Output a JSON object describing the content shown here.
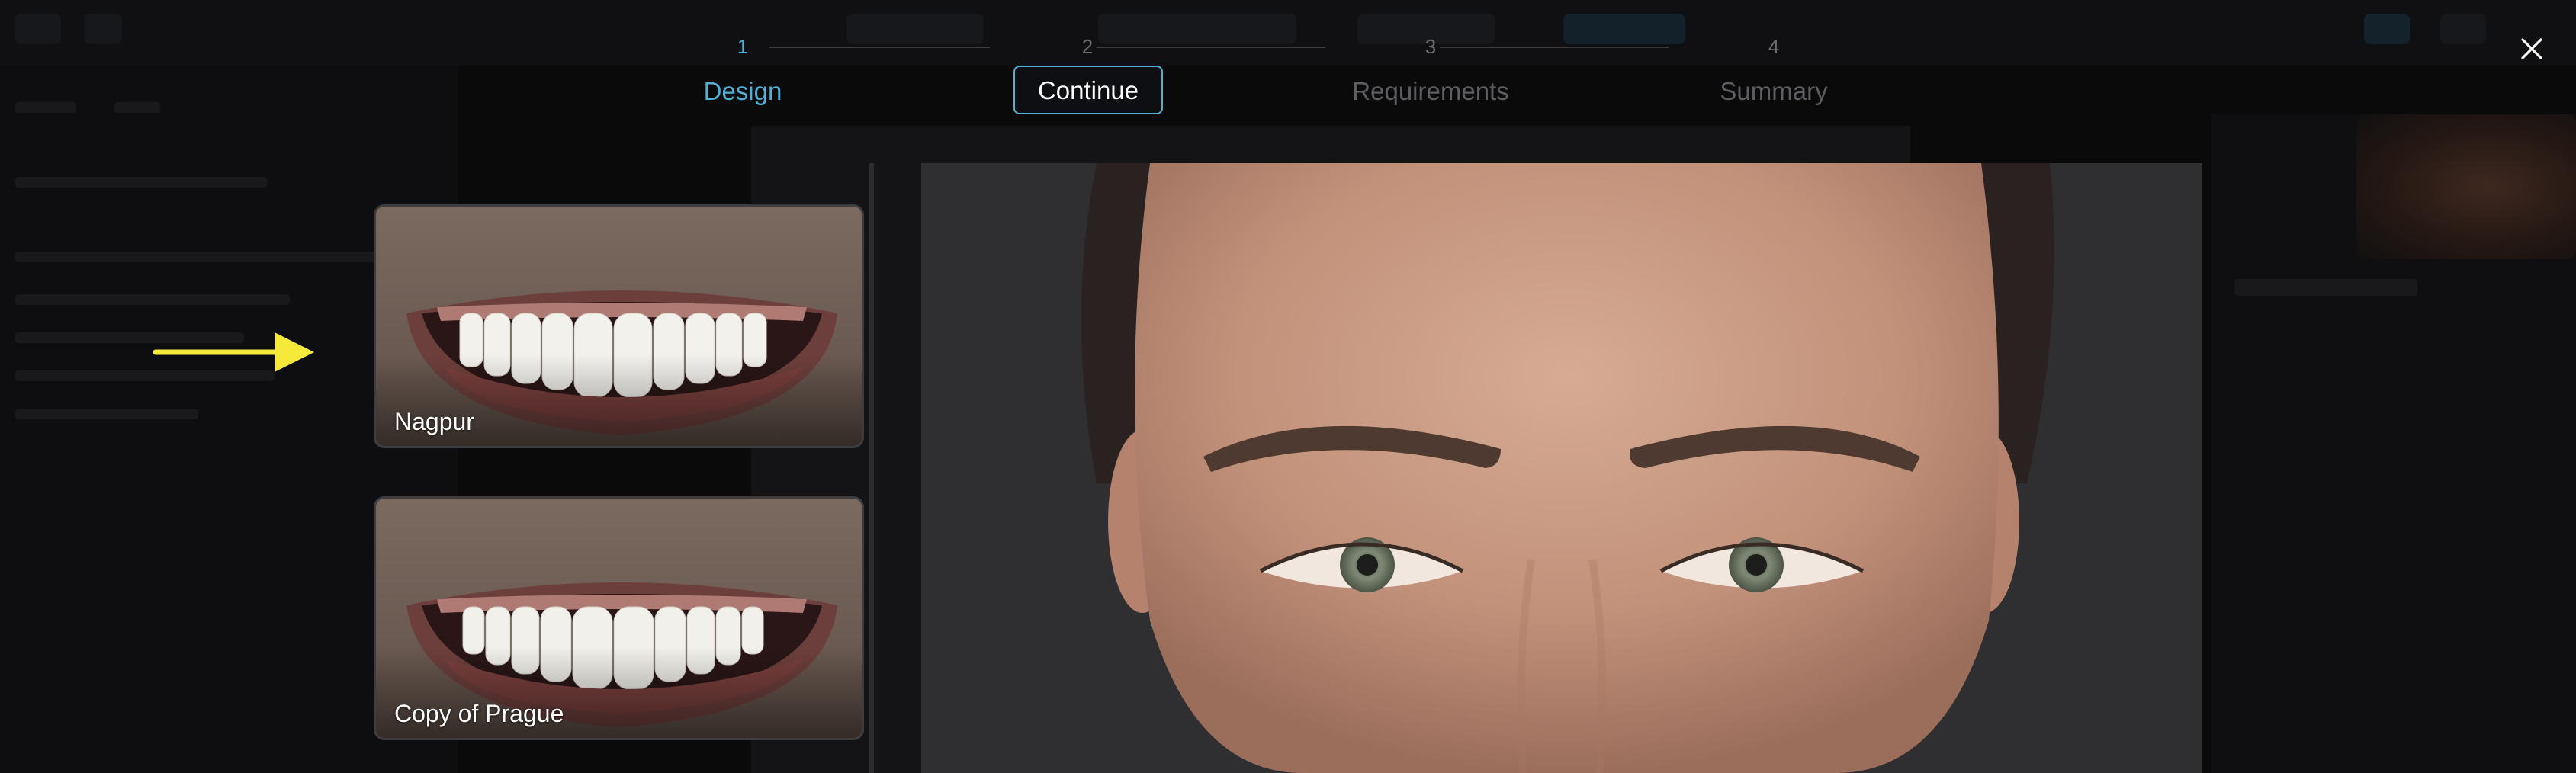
{
  "stepper": {
    "steps": [
      {
        "number": "1",
        "label": "Design",
        "state": "active"
      },
      {
        "number": "2",
        "label": "Continue",
        "state": "current-action"
      },
      {
        "number": "3",
        "label": "Requirements",
        "state": "inactive"
      },
      {
        "number": "4",
        "label": "Summary",
        "state": "inactive"
      }
    ]
  },
  "actions": {
    "continue_label": "Continue",
    "close_icon": "close-icon"
  },
  "designs": [
    {
      "label": "Nagpur",
      "selected": true
    },
    {
      "label": "Copy of Prague",
      "selected": false
    }
  ],
  "annotation": {
    "arrow_icon": "arrow-right-icon",
    "arrow_color": "#f5ea3a"
  },
  "colors": {
    "accent": "#4fb0d8",
    "inactive_text": "#5d5d62",
    "background": "#0a0a0b"
  }
}
